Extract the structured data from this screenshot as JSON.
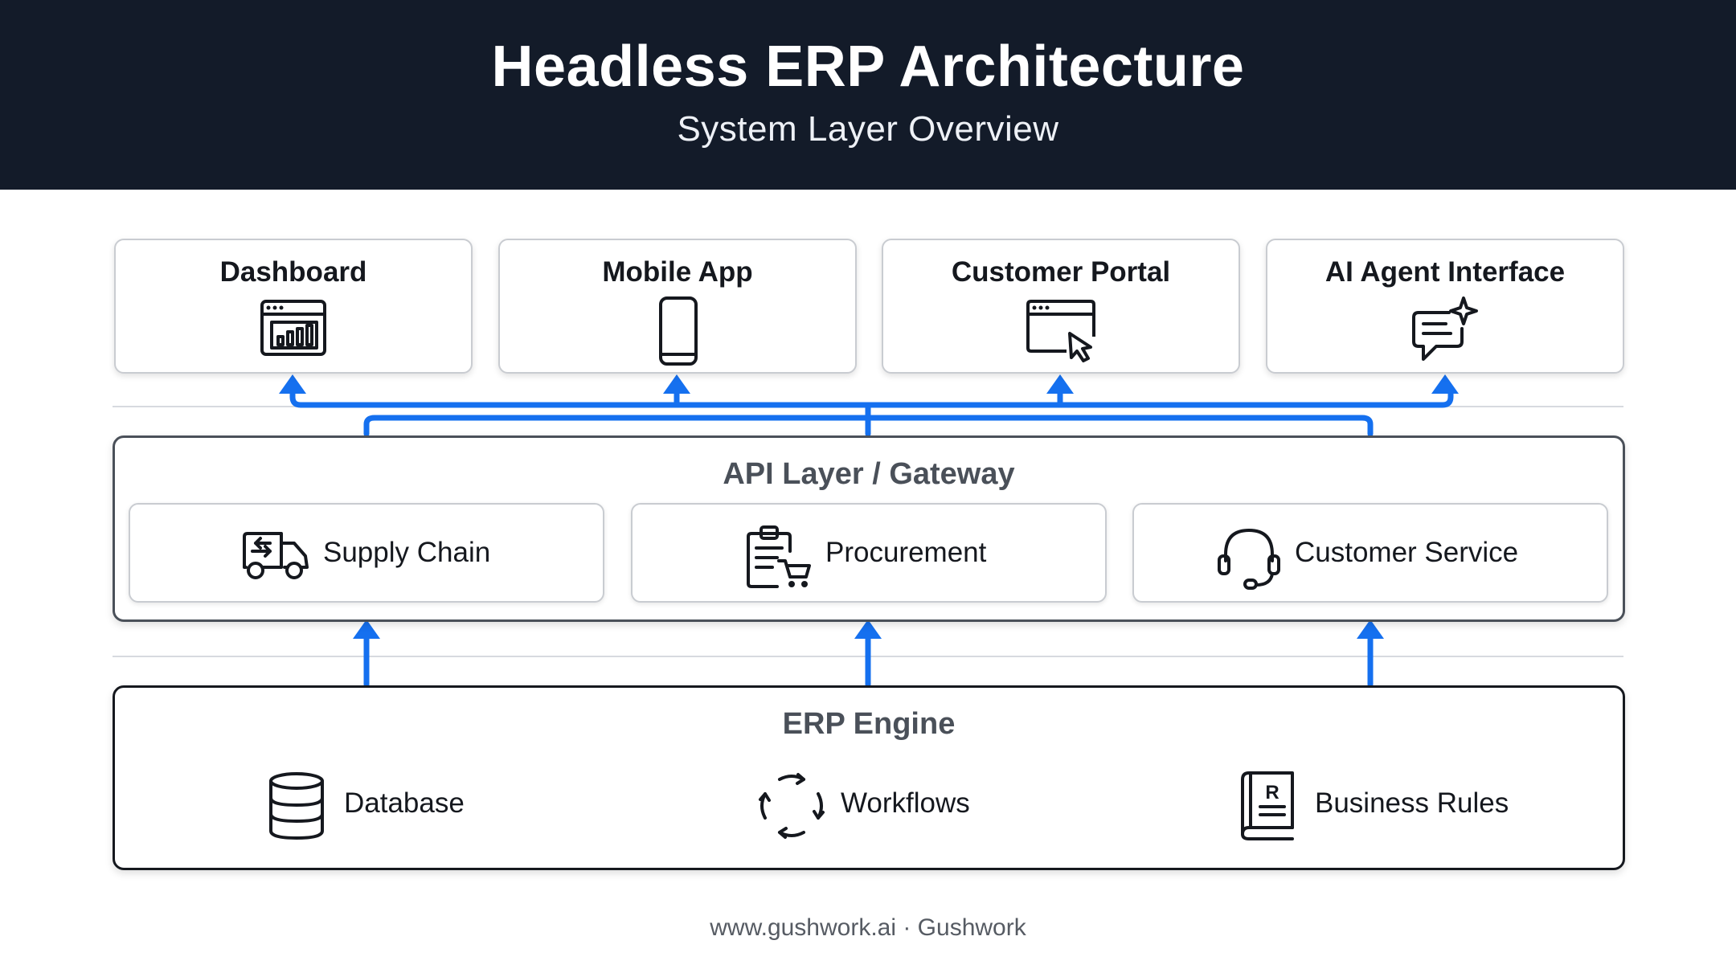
{
  "header": {
    "title": "Headless ERP Architecture",
    "subtitle": "System Layer Overview"
  },
  "interfaces": [
    {
      "label": "Dashboard",
      "icon": "dashboard-chart-icon"
    },
    {
      "label": "Mobile App",
      "icon": "mobile-phone-icon"
    },
    {
      "label": "Customer Portal",
      "icon": "browser-cursor-icon"
    },
    {
      "label": "AI Agent Interface",
      "icon": "chat-sparkle-icon"
    }
  ],
  "api_layer": {
    "title": "API Layer / Gateway",
    "modules": [
      {
        "label": "Supply Chain",
        "icon": "delivery-truck-icon"
      },
      {
        "label": "Procurement",
        "icon": "clipboard-cart-icon"
      },
      {
        "label": "Customer Service",
        "icon": "headset-icon"
      }
    ]
  },
  "engine": {
    "title": "ERP Engine",
    "items": [
      {
        "label": "Database",
        "icon": "database-icon"
      },
      {
        "label": "Workflows",
        "icon": "cycle-arrows-icon"
      },
      {
        "label": "Business Rules",
        "icon": "rule-book-icon"
      }
    ]
  },
  "colors": {
    "header_bg": "#131b29",
    "arrow_blue": "#1570ef",
    "text_dark": "#15181e",
    "layer_title": "#4a5059"
  },
  "footer": {
    "text": "www.gushwork.ai · Gushwork"
  }
}
